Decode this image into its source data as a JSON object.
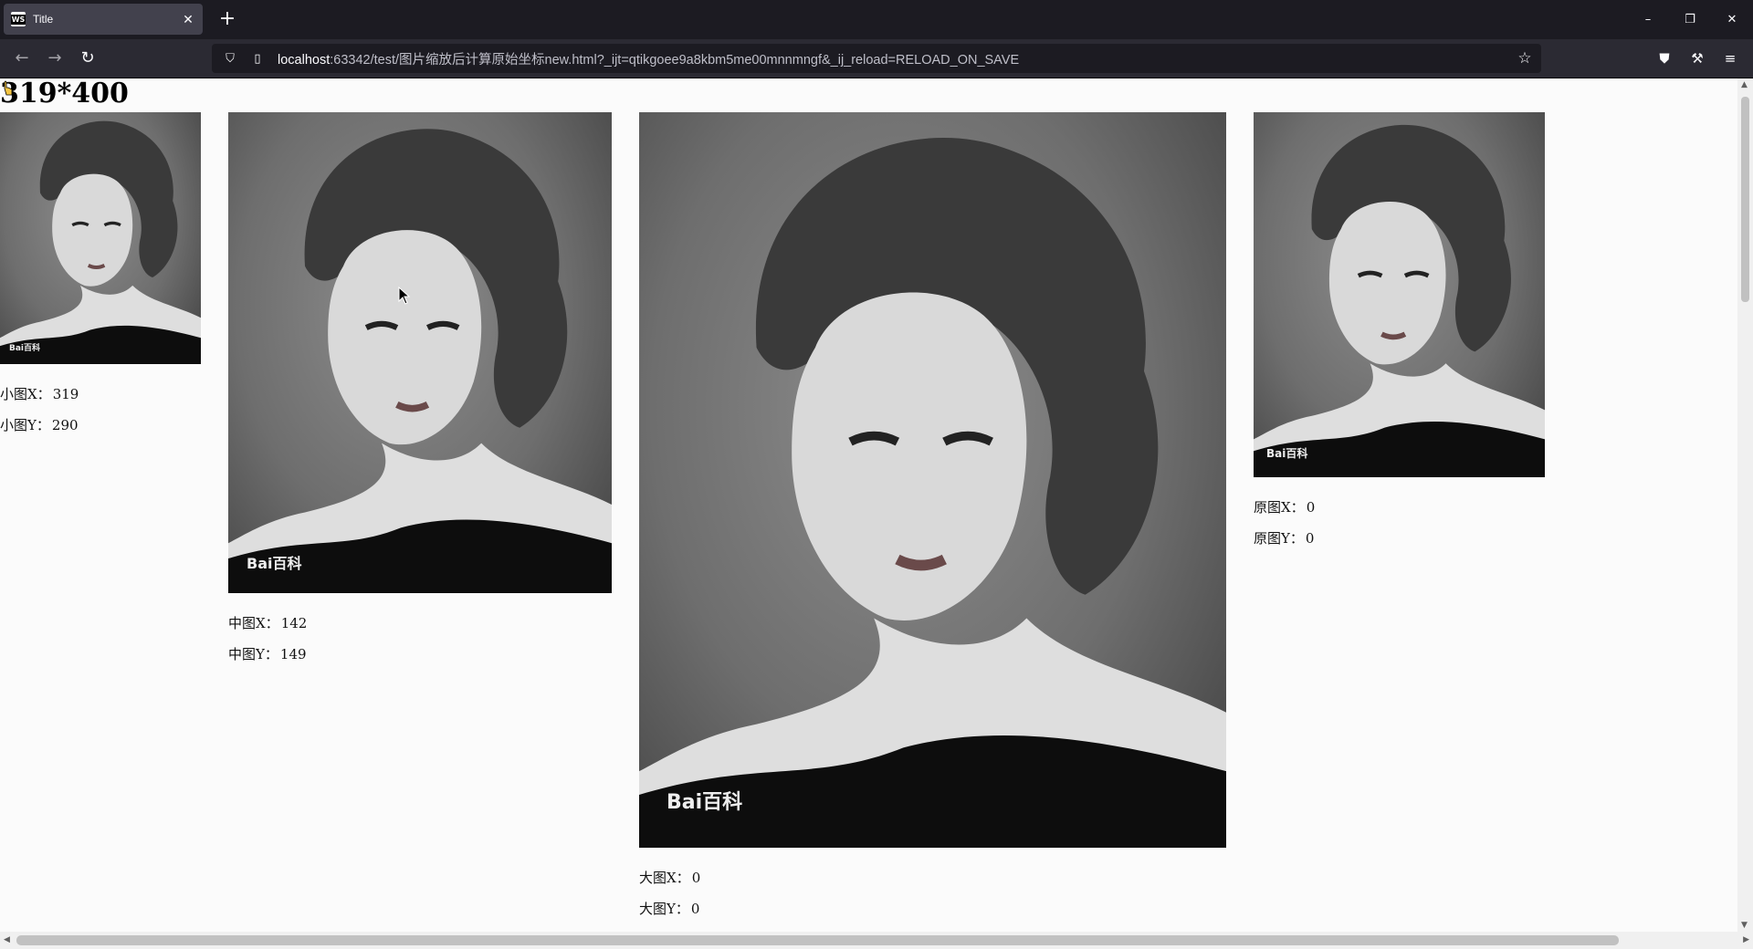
{
  "browser": {
    "tab_title": "Title",
    "tab_favicon": "WS",
    "url_host": "localhost",
    "url_rest": ":63342/test/图片缩放后计算原始坐标new.html?_ijt=qtikgoee9a8kbm5me00mnnmngf&_ij_reload=RELOAD_ON_SAVE",
    "icons": {
      "back": "arrow-left-icon",
      "forward": "arrow-right-icon",
      "reload": "reload-icon",
      "shield": "shield-icon",
      "page": "page-icon",
      "bookmark": "star-icon",
      "pocket": "pocket-icon",
      "extensions": "wrench-icon",
      "menu": "hamburger-menu-icon"
    }
  },
  "page": {
    "heading": "319*400",
    "watermark": "Bai百科",
    "small": {
      "x_label": "小图X：",
      "x_value": "319",
      "y_label": "小图Y：",
      "y_value": "290"
    },
    "medium": {
      "x_label": "中图X：",
      "x_value": "142",
      "y_label": "中图Y：",
      "y_value": "149"
    },
    "large": {
      "x_label": "大图X：",
      "x_value": "0",
      "y_label": "大图Y：",
      "y_value": "0"
    },
    "original": {
      "x_label": "原图X：",
      "x_value": "0",
      "y_label": "原图Y：",
      "y_value": "0"
    }
  },
  "colors": {
    "tabbar": "#1c1b22",
    "navbar": "#2b2a33",
    "page_bg": "#fbfbfb"
  }
}
